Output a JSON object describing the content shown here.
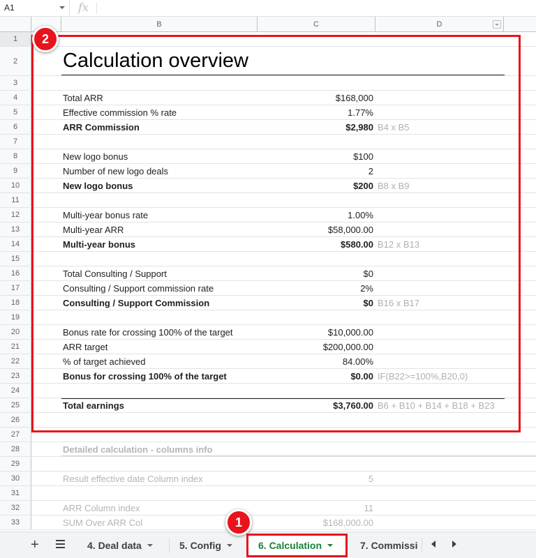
{
  "formula_bar": {
    "cell_ref": "A1",
    "fx_icon": "fx"
  },
  "columns": [
    "B",
    "C",
    "D"
  ],
  "title": "Calculation overview",
  "rows": [
    {
      "num": "1"
    },
    {
      "num": "2",
      "b": "Calculation overview"
    },
    {
      "num": "3"
    },
    {
      "num": "4",
      "b": "Total ARR",
      "c": "$168,000"
    },
    {
      "num": "5",
      "b": "Effective commission % rate",
      "c": "1.77%"
    },
    {
      "num": "6",
      "b": "ARR Commission",
      "c": "$2,980",
      "d": "B4 x B5"
    },
    {
      "num": "7"
    },
    {
      "num": "8",
      "b": "New logo bonus",
      "c": "$100"
    },
    {
      "num": "9",
      "b": "Number of new logo deals",
      "c": "2"
    },
    {
      "num": "10",
      "b": "New logo bonus",
      "c": "$200",
      "d": "B8 x B9"
    },
    {
      "num": "11"
    },
    {
      "num": "12",
      "b": "Multi-year bonus rate",
      "c": "1.00%"
    },
    {
      "num": "13",
      "b": "Multi-year ARR",
      "c": "$58,000.00"
    },
    {
      "num": "14",
      "b": "Multi-year bonus",
      "c": "$580.00",
      "d": "B12 x B13"
    },
    {
      "num": "15"
    },
    {
      "num": "16",
      "b": "Total Consulting / Support",
      "c": "$0"
    },
    {
      "num": "17",
      "b": "Consulting / Support commission rate",
      "c": "2%"
    },
    {
      "num": "18",
      "b": "Consulting / Support Commission",
      "c": "$0",
      "d": "B16 x B17"
    },
    {
      "num": "19"
    },
    {
      "num": "20",
      "b": "Bonus rate for crossing 100% of the target",
      "c": "$10,000.00"
    },
    {
      "num": "21",
      "b": "ARR target",
      "c": "$200,000.00"
    },
    {
      "num": "22",
      "b": "% of target achieved",
      "c": "84.00%"
    },
    {
      "num": "23",
      "b": "Bonus for crossing 100% of the target",
      "c": "$0.00",
      "d": "IF(B22>=100%,B20,0)"
    },
    {
      "num": "24"
    },
    {
      "num": "25",
      "b": "Total earnings",
      "c": "$3,760.00",
      "d": "B6 + B10 + B14 + B18 + B23"
    },
    {
      "num": "26"
    },
    {
      "num": "27"
    },
    {
      "num": "28",
      "b": "Detailed calculation - columns info"
    },
    {
      "num": "29"
    },
    {
      "num": "30",
      "b": "Result effective date Column index",
      "c": "5"
    },
    {
      "num": "31"
    },
    {
      "num": "32",
      "b": "ARR Column index",
      "c": "11"
    },
    {
      "num": "33",
      "b": "SUM Over ARR Col",
      "c": "$168,000.00"
    }
  ],
  "badges": {
    "one": "1",
    "two": "2"
  },
  "sheet_tabs": {
    "add_icon": "+",
    "list_icon": "sheet-list-icon",
    "tabs": [
      "4. Deal data",
      "5. Config",
      "6. Calculation",
      "7. Commissi"
    ]
  },
  "colors": {
    "highlight": "#e8131d",
    "active_tab_text": "#188038"
  }
}
